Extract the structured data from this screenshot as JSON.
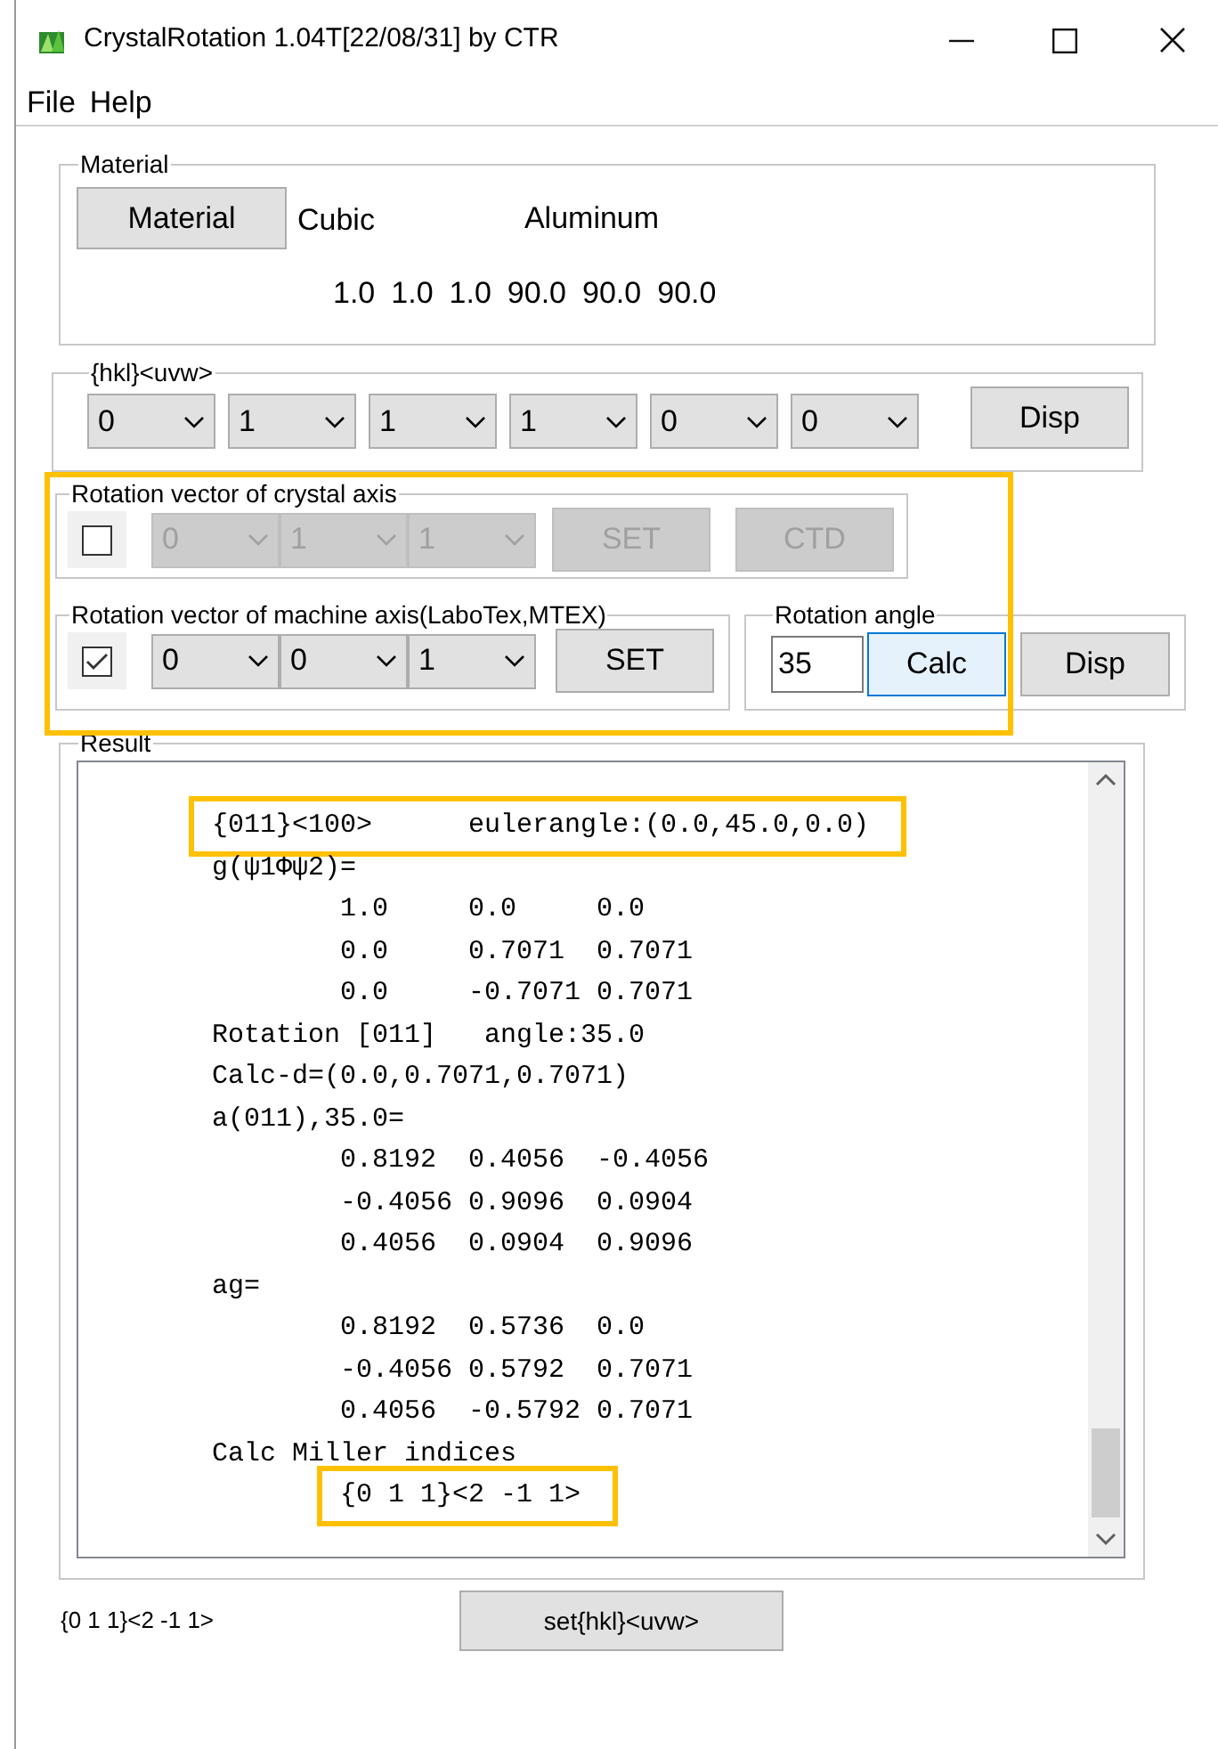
{
  "window": {
    "title": "CrystalRotation 1.04T[22/08/31] by CTR"
  },
  "menu": [
    "File",
    "Help"
  ],
  "material": {
    "label": "Material",
    "button": "Material",
    "crystal_system": "Cubic",
    "name": "Aluminum",
    "lattice": [
      "1.0",
      "1.0",
      "1.0",
      "90.0",
      "90.0",
      "90.0"
    ]
  },
  "hkl_uvw": {
    "label": "{hkl}<uvw>",
    "combos": [
      "0",
      "1",
      "1",
      "1",
      "0",
      "0"
    ],
    "button": "Disp"
  },
  "crystal_axis": {
    "label": "Rotation vector of crystal axis",
    "checked": false,
    "disabled": true,
    "combos": [
      "0",
      "1",
      "1"
    ],
    "buttons": [
      "SET",
      "CTD"
    ]
  },
  "machine_axis": {
    "label": "Rotation vector of machine axis(LaboTex,MTEX)",
    "checked": true,
    "disabled": false,
    "combos": [
      "0",
      "0",
      "1"
    ],
    "button": "SET"
  },
  "rotation_angle": {
    "label": "Rotation angle",
    "value": "35",
    "buttons": [
      {
        "label": "Calc",
        "focused": true
      },
      {
        "label": "Disp",
        "focused": false
      }
    ]
  },
  "result": {
    "label": "Result",
    "lines": [
      {
        "text": "{011}<100>      eulerangle:(0.0,45.0,0.0)",
        "highlighted": true
      },
      {
        "text": "g(ψ1Φψ2)=",
        "highlighted": false
      },
      {
        "text": "        1.0     0.0     0.0",
        "highlighted": false
      },
      {
        "text": "        0.0     0.7071  0.7071",
        "highlighted": false
      },
      {
        "text": "        0.0     -0.7071 0.7071",
        "highlighted": false
      },
      {
        "text": "Rotation [011]   angle:35.0",
        "highlighted": false
      },
      {
        "text": "Calc-d=(0.0,0.7071,0.7071)",
        "highlighted": false
      },
      {
        "text": "a(011),35.0=",
        "highlighted": false
      },
      {
        "text": "        0.8192  0.4056  -0.4056",
        "highlighted": false
      },
      {
        "text": "        -0.4056 0.9096  0.0904",
        "highlighted": false
      },
      {
        "text": "        0.4056  0.0904  0.9096",
        "highlighted": false
      },
      {
        "text": "ag=",
        "highlighted": false
      },
      {
        "text": "        0.8192  0.5736  0.0",
        "highlighted": false
      },
      {
        "text": "        -0.4056 0.5792  0.7071",
        "highlighted": false
      },
      {
        "text": "        0.4056  -0.5792 0.7071",
        "highlighted": false
      },
      {
        "text": "Calc Miller indices",
        "highlighted": false
      },
      {
        "text": "        {0 1 1}<2 -1 1>",
        "highlighted": true
      }
    ]
  },
  "footer": {
    "indices": "{0 1 1}<2 -1 1>",
    "button": "set{hkl}<uvw>"
  }
}
